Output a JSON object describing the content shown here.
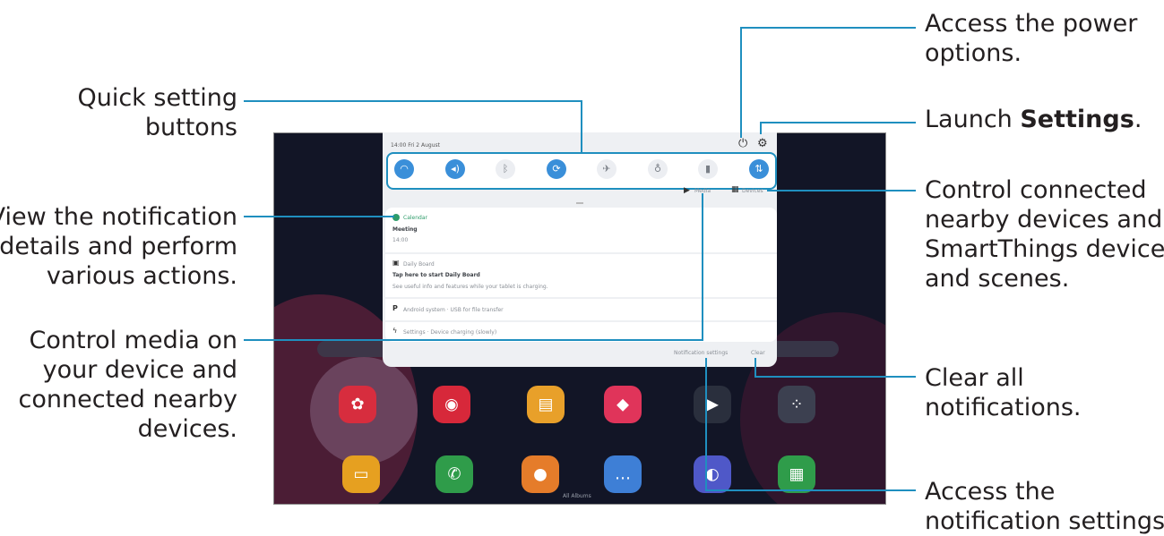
{
  "callouts": {
    "power": [
      "Access the power",
      "options."
    ],
    "settings_prefix": "Launch ",
    "settings_bold": "Settings",
    "settings_suffix": ".",
    "connected": [
      "Control connected",
      "nearby devices and",
      "SmartThings devices",
      "and scenes."
    ],
    "clear": [
      "Clear all",
      "notifications."
    ],
    "notif_settings": [
      "Access the",
      "notification settings."
    ],
    "quick": [
      "Quick setting",
      "buttons"
    ],
    "view": [
      "View the notification",
      "details and perform",
      "various actions."
    ],
    "media": [
      "Control media on",
      "your device and",
      "connected nearby",
      "devices."
    ]
  },
  "screen": {
    "datetime": "14:00  Fri 2 August",
    "media_label": "Media",
    "devices_label": "Devices",
    "notif1_app": "Calendar",
    "notif1_title": "Meeting",
    "notif1_time": "14:00",
    "notif2_app": "Daily Board",
    "notif2_title": "Tap here to start Daily Board",
    "notif2_body": "See useful info and features while your tablet is charging.",
    "notif3": "Android system · USB for file transfer",
    "notif4": "Settings · Device charging (slowly)",
    "notification_settings": "Notification settings",
    "clear": "Clear",
    "dock_label": "All Albums"
  },
  "colors": {
    "accent_line": "#1f8fbf",
    "tablet_bg": "#121526",
    "qs_on": "#3a8fd9"
  },
  "quick_settings_icons": [
    "wifi-icon",
    "sound-icon",
    "bluetooth-icon",
    "auto-rotate-icon",
    "airplane-mode-icon",
    "flashlight-icon",
    "power-saving-icon",
    "mobile-data-icon"
  ],
  "quick_settings_states": [
    true,
    true,
    false,
    true,
    false,
    false,
    false,
    true
  ]
}
